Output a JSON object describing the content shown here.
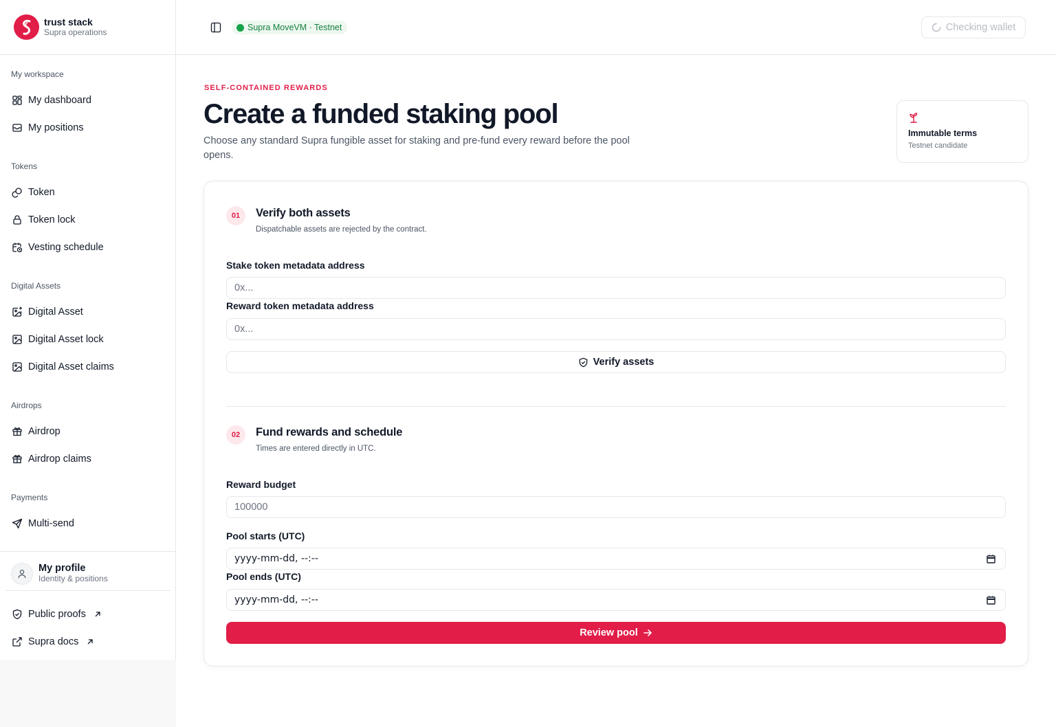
{
  "brand": {
    "name": "trust stack",
    "subtitle": "Supra operations"
  },
  "sidebar": {
    "groups": [
      {
        "label": "My workspace",
        "items": [
          {
            "label": "My dashboard",
            "icon": "layout-grid-icon"
          },
          {
            "label": "My positions",
            "icon": "inbox-icon"
          }
        ]
      },
      {
        "label": "Tokens",
        "items": [
          {
            "label": "Token",
            "icon": "coins-icon"
          },
          {
            "label": "Token lock",
            "icon": "lock-icon"
          },
          {
            "label": "Vesting schedule",
            "icon": "calendar-clock-icon"
          }
        ]
      },
      {
        "label": "Digital Assets",
        "items": [
          {
            "label": "Digital Asset",
            "icon": "image-plus-icon"
          },
          {
            "label": "Digital Asset lock",
            "icon": "image-icon"
          },
          {
            "label": "Digital Asset claims",
            "icon": "image-icon"
          }
        ]
      },
      {
        "label": "Airdrops",
        "items": [
          {
            "label": "Airdrop",
            "icon": "gift-icon"
          },
          {
            "label": "Airdrop claims",
            "icon": "gift-icon"
          }
        ]
      },
      {
        "label": "Payments",
        "items": [
          {
            "label": "Multi-send",
            "icon": "send-icon"
          }
        ]
      }
    ],
    "profile": {
      "name": "My profile",
      "subtitle": "Identity & positions"
    },
    "footer_links": [
      {
        "label": "Public proofs",
        "icon": "shield-check-icon"
      },
      {
        "label": "Supra docs",
        "icon": "external-link-icon"
      }
    ]
  },
  "header": {
    "network": "Supra MoveVM · Testnet",
    "wallet_label": "Checking wallet"
  },
  "main": {
    "eyebrow": "SELF-CONTAINED REWARDS",
    "title": "Create a funded staking pool",
    "description": "Choose any standard Supra fungible asset for staking and pre-fund every reward before the pool opens.",
    "terms_card": {
      "title": "Immutable terms",
      "subtitle": "Testnet candidate"
    },
    "steps": [
      {
        "number": "01",
        "title": "Verify both assets",
        "subtitle": "Dispatchable assets are rejected by the contract.",
        "fields": [
          {
            "label": "Stake token metadata address",
            "placeholder": "0x..."
          },
          {
            "label": "Reward token metadata address",
            "placeholder": "0x..."
          }
        ],
        "button": "Verify assets"
      },
      {
        "number": "02",
        "title": "Fund rewards and schedule",
        "subtitle": "Times are entered directly in UTC.",
        "fields": [
          {
            "label": "Reward budget",
            "placeholder": "100000"
          },
          {
            "label": "Pool starts (UTC)",
            "value": "yyyy-mm-dd, --:--"
          },
          {
            "label": "Pool ends (UTC)",
            "value": "yyyy-mm-dd, --:--"
          }
        ],
        "button": "Review pool"
      }
    ]
  },
  "colors": {
    "accent": "#e11d48",
    "accent_soft": "#fde8ec",
    "network_green": "#16a34a",
    "border": "#e5e7eb"
  }
}
